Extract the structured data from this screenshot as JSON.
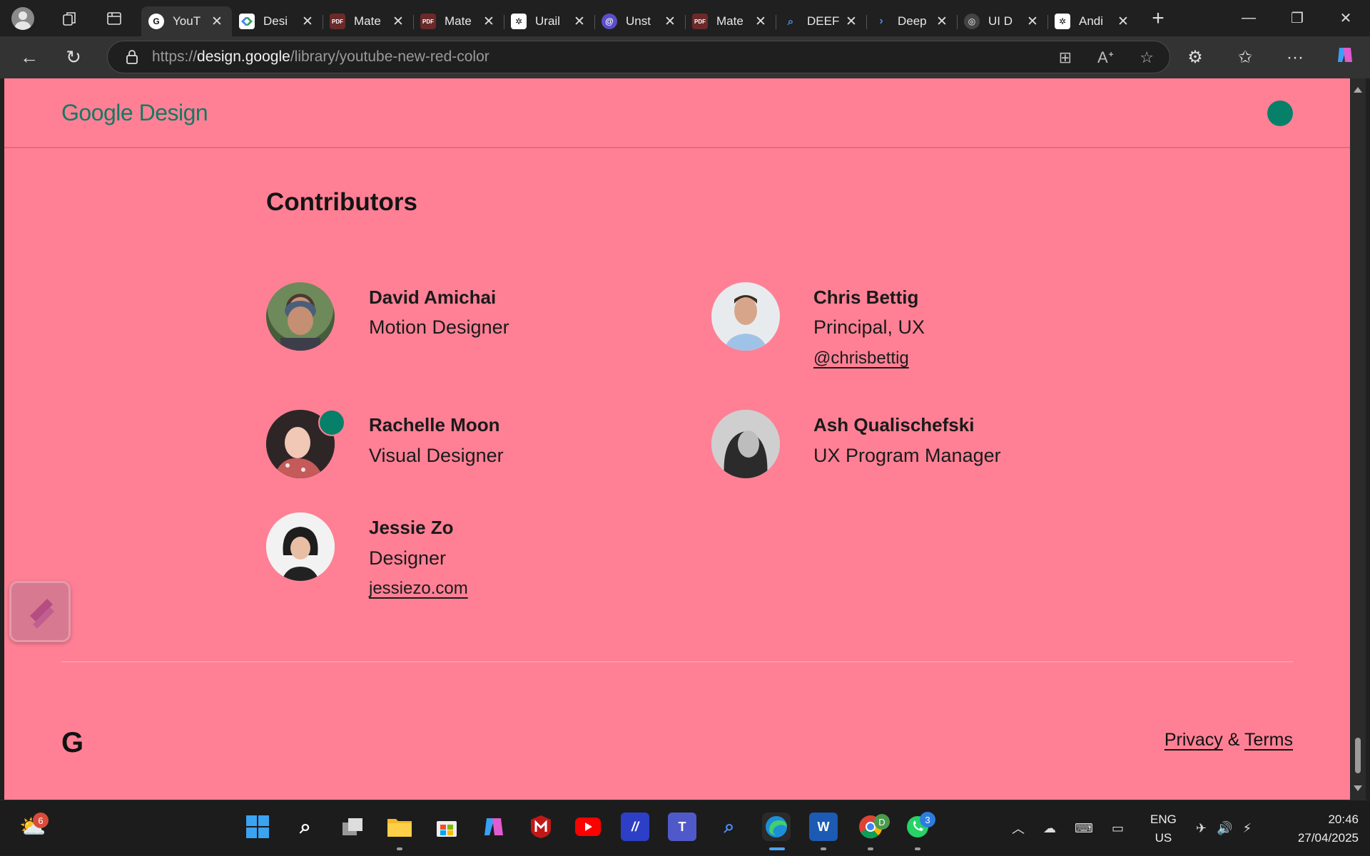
{
  "browser": {
    "tabs": [
      {
        "label": "YouT",
        "favicon": "google-g-icon",
        "active": true
      },
      {
        "label": "Desi",
        "favicon": "design-icon"
      },
      {
        "label": "Mate",
        "favicon": "pdf-icon"
      },
      {
        "label": "Mate",
        "favicon": "pdf-icon"
      },
      {
        "label": "Urail",
        "favicon": "openai-icon"
      },
      {
        "label": "Unst",
        "favicon": "swirl-icon"
      },
      {
        "label": "Mate",
        "favicon": "pdf-icon"
      },
      {
        "label": "DEEF",
        "favicon": "search-icon"
      },
      {
        "label": "Deep",
        "favicon": "chevron-icon"
      },
      {
        "label": "UI D",
        "favicon": "chatgpt-icon"
      },
      {
        "label": "Andi",
        "favicon": "openai-icon"
      }
    ],
    "url_prefix": "https://",
    "url_domain": "design.google",
    "url_path": "/library/youtube-new-red-color"
  },
  "header": {
    "logo_google": "Google",
    "logo_design": "Design"
  },
  "contributors": {
    "title": "Contributors",
    "people": [
      {
        "name": "David Amichai",
        "role": "Motion Designer",
        "link": ""
      },
      {
        "name": "Chris Bettig",
        "role": "Principal, UX",
        "link": "@chrisbettig"
      },
      {
        "name": "Rachelle Moon",
        "role": "Visual Designer",
        "link": ""
      },
      {
        "name": "Ash Qualischefski",
        "role": "UX Program Manager",
        "link": ""
      },
      {
        "name": "Jessie Zo",
        "role": "Designer",
        "link": "jessiezo.com"
      }
    ]
  },
  "footer": {
    "logo": "G",
    "privacy": "Privacy",
    "amp": "&",
    "terms": "Terms"
  },
  "taskbar": {
    "weather_badge": "6",
    "chrome_badge": "D",
    "whatsapp_badge": "3",
    "lang_line1": "ENG",
    "lang_line2": "US",
    "time": "20:46",
    "date": "27/04/2025"
  },
  "colors": {
    "page_bg": "#ff8095",
    "accent_green": "#07806a",
    "logo_green": "#127a63"
  }
}
